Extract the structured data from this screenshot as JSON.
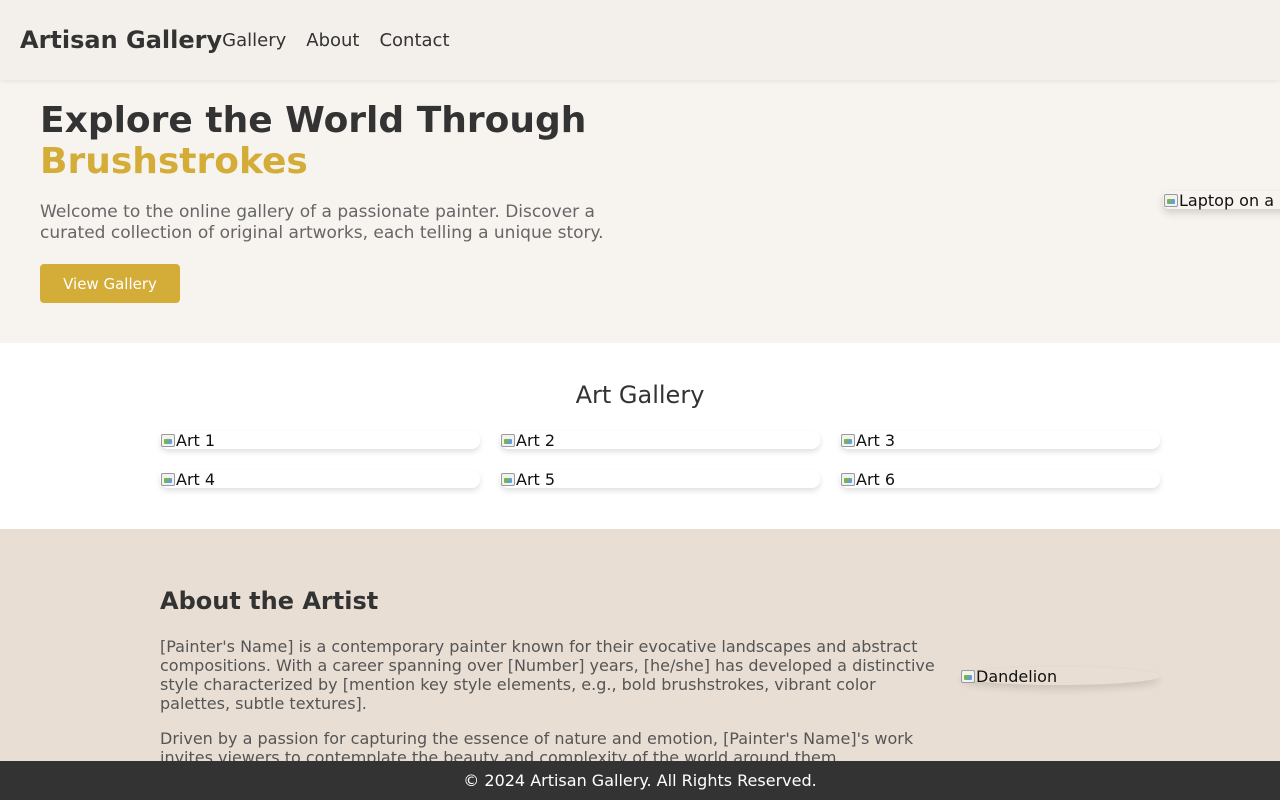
{
  "header": {
    "logo": "Artisan Gallery",
    "nav": [
      "Gallery",
      "About",
      "Contact"
    ]
  },
  "hero": {
    "title_line1": "Explore the World Through",
    "title_accent": "Brushstrokes",
    "description": "Welcome to the online gallery of a passionate painter. Discover a curated collection of original artworks, each telling a unique story.",
    "button_label": "View Gallery",
    "image_alt": "Laptop on a"
  },
  "gallery": {
    "title": "Art Gallery",
    "items": [
      "Art 1",
      "Art 2",
      "Art 3",
      "Art 4",
      "Art 5",
      "Art 6"
    ]
  },
  "about": {
    "title": "About the Artist",
    "paragraph1": "[Painter's Name] is a contemporary painter known for their evocative landscapes and abstract compositions. With a career spanning over [Number] years, [he/she] has developed a distinctive style characterized by [mention key style elements, e.g., bold brushstrokes, vibrant color palettes, subtle textures].",
    "paragraph2": "Driven by a passion for capturing the essence of nature and emotion, [Painter's Name]'s work invites viewers to contemplate the beauty and complexity of the world around them.",
    "image_alt": "Dandelion"
  },
  "footer": {
    "text": "© 2024 Artisan Gallery. All Rights Reserved."
  },
  "colors": {
    "accent": "#d4ac38",
    "header_bg": "#f3efea",
    "hero_bg": "#f7f3ef",
    "about_bg": "#e8ded3",
    "footer_bg": "#333333"
  }
}
